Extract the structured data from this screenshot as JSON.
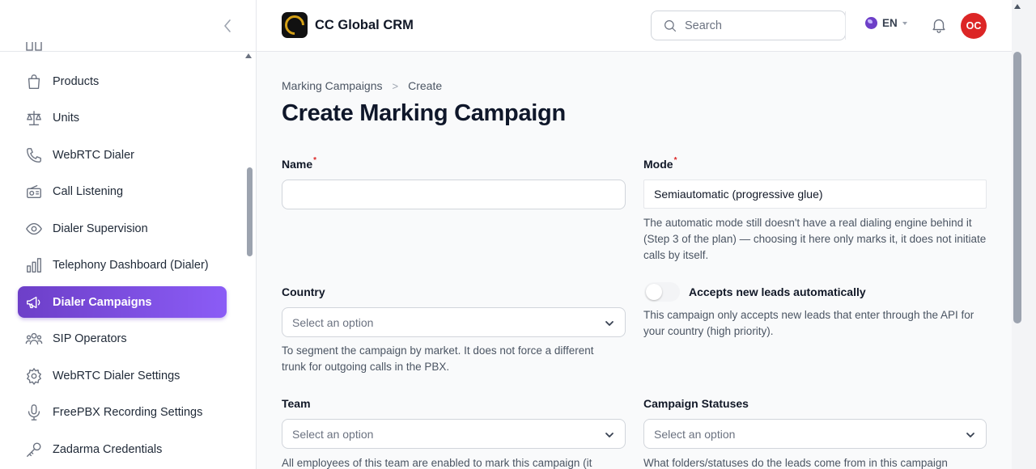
{
  "app": {
    "brand": "CC Global CRM"
  },
  "header": {
    "search_placeholder": "Search",
    "language": "EN",
    "avatar_initials": "OC"
  },
  "sidebar": {
    "items": [
      {
        "label": "Products",
        "icon": "shopping-bag-icon"
      },
      {
        "label": "Units",
        "icon": "scale-icon"
      },
      {
        "label": "WebRTC Dialer",
        "icon": "phone-icon"
      },
      {
        "label": "Call Listening",
        "icon": "radio-icon"
      },
      {
        "label": "Dialer Supervision",
        "icon": "eye-icon"
      },
      {
        "label": "Telephony Dashboard (Dialer)",
        "icon": "chart-bar-icon"
      },
      {
        "label": "Dialer Campaigns",
        "icon": "megaphone-icon",
        "active": true
      },
      {
        "label": "SIP Operators",
        "icon": "user-group-icon"
      },
      {
        "label": "WebRTC Dialer Settings",
        "icon": "cog-icon"
      },
      {
        "label": "FreePBX Recording Settings",
        "icon": "microphone-icon"
      },
      {
        "label": "Zadarma Credentials",
        "icon": "key-icon"
      }
    ]
  },
  "breadcrumb": {
    "parent": "Marking Campaigns",
    "current": "Create"
  },
  "page": {
    "title": "Create Marking Campaign"
  },
  "form": {
    "name": {
      "label": "Name",
      "value": ""
    },
    "mode": {
      "label": "Mode",
      "value": "Semiautomatic (progressive glue)",
      "help": "The automatic mode still doesn't have a real dialing engine behind it (Step 3 of the plan) — choosing it here only marks it, it does not initiate calls by itself."
    },
    "country": {
      "label": "Country",
      "placeholder": "Select an option",
      "help": "To segment the campaign by market. It does not force a different trunk for outgoing calls in the PBX."
    },
    "accepts_new_leads": {
      "label": "Accepts new leads automatically",
      "enabled": false,
      "help": "This campaign only accepts new leads that enter through the API for your country (high priority)."
    },
    "team": {
      "label": "Team",
      "placeholder": "Select an option",
      "help": "All employees of this team are enabled to mark this campaign (it"
    },
    "campaign_statuses": {
      "label": "Campaign Statuses",
      "placeholder": "Select an option",
      "help": "What folders/statuses do the leads come from in this campaign"
    }
  },
  "colors": {
    "accent": "#6d3fc8",
    "avatar": "#dc2626",
    "required": "#dc2626"
  }
}
